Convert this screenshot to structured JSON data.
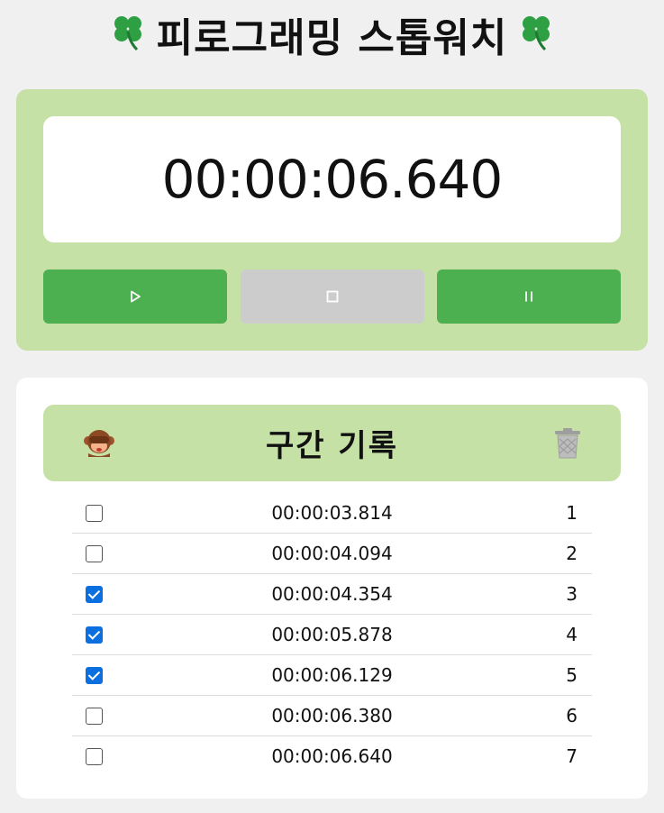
{
  "header": {
    "title": "피로그래밍 스톱워치",
    "left_icon": "four-leaf-clover",
    "right_icon": "four-leaf-clover"
  },
  "stopwatch": {
    "display": "00:00:06.640",
    "buttons": {
      "start_icon": "play-icon",
      "stop_icon": "stop-icon",
      "pause_icon": "pause-icon"
    },
    "colors": {
      "card_bg": "#c5e1a5",
      "active_button": "#4caf50",
      "disabled_button": "#cccccc"
    }
  },
  "laps": {
    "title": "구간 기록",
    "select_all_icon": "see-no-evil-monkey",
    "delete_icon": "trash-can",
    "items": [
      {
        "time": "00:00:03.814",
        "index": "1",
        "checked": false
      },
      {
        "time": "00:00:04.094",
        "index": "2",
        "checked": false
      },
      {
        "time": "00:00:04.354",
        "index": "3",
        "checked": true
      },
      {
        "time": "00:00:05.878",
        "index": "4",
        "checked": true
      },
      {
        "time": "00:00:06.129",
        "index": "5",
        "checked": true
      },
      {
        "time": "00:00:06.380",
        "index": "6",
        "checked": false
      },
      {
        "time": "00:00:06.640",
        "index": "7",
        "checked": false
      }
    ]
  }
}
